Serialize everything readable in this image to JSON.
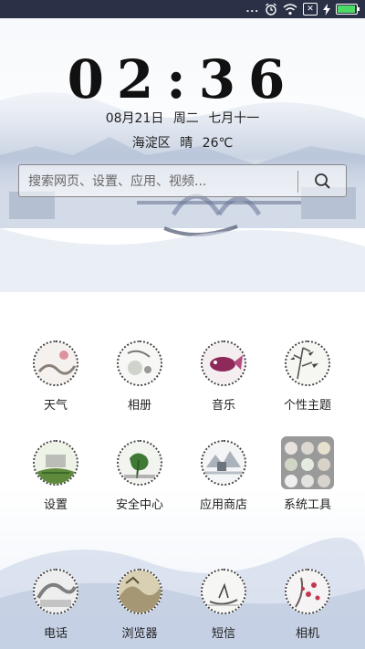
{
  "status_bar": {
    "dots": "...",
    "icons": [
      "alarm-icon",
      "wifi-icon",
      "sim-icon",
      "charging-icon",
      "battery-icon"
    ],
    "battery_level": 0.95
  },
  "lockscreen": {
    "time": "02:36",
    "date": "08月21日",
    "weekday": "周二",
    "lunar_date": "七月十一",
    "location": "海淀区",
    "weather": "晴",
    "temperature": "26℃"
  },
  "search": {
    "placeholder": "搜索网页、设置、应用、视频..."
  },
  "apps_row1": [
    {
      "label": "天气",
      "icon": "weather-icon"
    },
    {
      "label": "相册",
      "icon": "gallery-icon"
    },
    {
      "label": "音乐",
      "icon": "music-icon"
    },
    {
      "label": "个性主题",
      "icon": "themes-icon"
    }
  ],
  "apps_row2": [
    {
      "label": "设置",
      "icon": "settings-icon"
    },
    {
      "label": "安全中心",
      "icon": "security-icon"
    },
    {
      "label": "应用商店",
      "icon": "app-store-icon"
    },
    {
      "label": "系统工具",
      "icon": "folder-icon"
    }
  ],
  "dock": [
    {
      "label": "电话",
      "icon": "phone-icon"
    },
    {
      "label": "浏览器",
      "icon": "browser-icon"
    },
    {
      "label": "短信",
      "icon": "messages-icon"
    },
    {
      "label": "相机",
      "icon": "camera-icon"
    }
  ],
  "colors": {
    "status_bar": "#2a3147",
    "ink": "#222222",
    "wash": "#b8c6de"
  }
}
